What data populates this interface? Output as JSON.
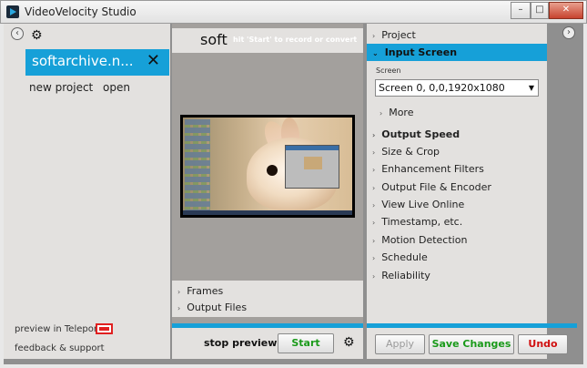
{
  "window": {
    "title": "VideoVelocity Studio",
    "controls": {
      "minimize": "–",
      "maximize": "□",
      "close": "✕"
    }
  },
  "left_panel": {
    "nav_left": "‹",
    "gear": "⚙",
    "project_tab": {
      "label": "softarchive.n...",
      "close": "✕"
    },
    "links": {
      "new_project": "new project",
      "open": "open"
    },
    "preview_in_teleport": "preview in Teleport",
    "feedback": "feedback & support"
  },
  "center_panel": {
    "tab_label": "soft",
    "hint": "hit 'Start' to record or convert",
    "accordion": [
      {
        "label": "Frames",
        "chevron": "›"
      },
      {
        "label": "Output Files",
        "chevron": "›"
      }
    ],
    "stop_preview": "stop preview",
    "start_button": "Start",
    "gear": "⚙",
    "colors": {
      "accent": "#16a0d8",
      "start_text": "#1a9a1a"
    }
  },
  "right_panel": {
    "nav_right": "›",
    "items": [
      {
        "label": "Project",
        "chevron": "›",
        "bold": false,
        "selected": false
      },
      {
        "label": "Input Screen",
        "chevron": "⌄",
        "bold": true,
        "selected": true
      }
    ],
    "screen_label": "Screen",
    "screen_select": {
      "value": "Screen 0, 0,0,1920x1080",
      "arrow": "▼"
    },
    "more": {
      "label": "More",
      "chevron": "›"
    },
    "sections": [
      {
        "label": "Output Speed",
        "chevron": "›",
        "bold": true
      },
      {
        "label": "Size & Crop",
        "chevron": "›",
        "bold": false
      },
      {
        "label": "Enhancement Filters",
        "chevron": "›",
        "bold": false
      },
      {
        "label": "Output File & Encoder",
        "chevron": "›",
        "bold": false
      },
      {
        "label": "View Live Online",
        "chevron": "›",
        "bold": false
      },
      {
        "label": "Timestamp, etc.",
        "chevron": "›",
        "bold": false
      },
      {
        "label": "Motion Detection",
        "chevron": "›",
        "bold": false
      },
      {
        "label": "Schedule",
        "chevron": "›",
        "bold": false
      },
      {
        "label": "Reliability",
        "chevron": "›",
        "bold": false
      }
    ],
    "buttons": {
      "apply": "Apply",
      "save_changes": "Save Changes",
      "undo": "Undo"
    },
    "colors": {
      "save_text": "#1a9a1a",
      "undo_text": "#d01010",
      "apply_text": "#9a9a9a"
    }
  }
}
